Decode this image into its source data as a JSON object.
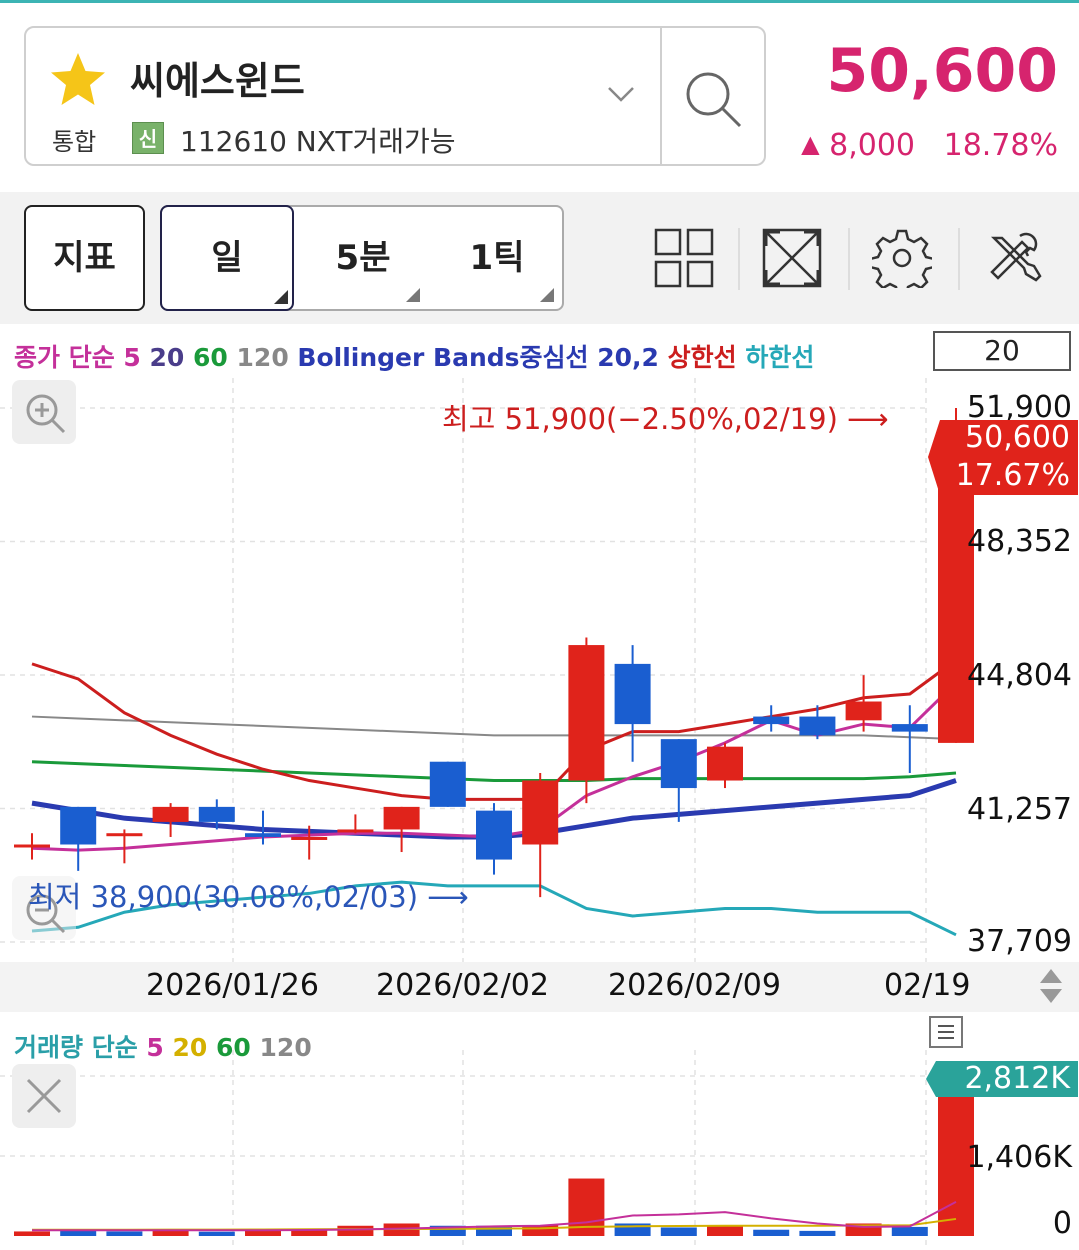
{
  "header": {
    "stock_name": "씨에스윈드",
    "market": "통합",
    "new_badge": "신",
    "code_text": "112610 NXT거래가능",
    "price": "50,600",
    "change_arrow": "▲",
    "change": "8,000",
    "change_pct": "18.78%",
    "price_color": "#d6246e"
  },
  "toolbar": {
    "indicator_label": "지표",
    "tabs": [
      {
        "label": "일",
        "selected": true
      },
      {
        "label": "5분",
        "selected": false
      },
      {
        "label": "1틱",
        "selected": false
      }
    ],
    "icons": [
      "grid-layout-icon",
      "expand-icon",
      "settings-gear-icon",
      "tools-icon"
    ]
  },
  "chart": {
    "legend_items": [
      {
        "text": "종가 단순 ",
        "color": "#c4309a"
      },
      {
        "text": "5 ",
        "color": "#c4309a"
      },
      {
        "text": "20 ",
        "color": "#4a3d8a"
      },
      {
        "text": "60 ",
        "color": "#1a9a3a"
      },
      {
        "text": "120 ",
        "color": "#888888"
      },
      {
        "text": "Bollinger Bands중심선 20,2 ",
        "color": "#2a3ab0"
      },
      {
        "text": "상한선 ",
        "color": "#cc1e1e"
      },
      {
        "text": "하한선",
        "color": "#25a8b8"
      }
    ],
    "period_value": "20",
    "high_annotation": "최고 51,900(−2.50%,02/19) ⟶",
    "low_annotation": "최저 38,900(30.08%,02/03) ⟶",
    "current_price_badge": "50,600",
    "current_pct_badge": "17.67%",
    "y_labels": [
      "51,900",
      "48,352",
      "44,804",
      "41,257",
      "37,709"
    ],
    "x_labels": [
      "2026/01/26",
      "2026/02/02",
      "2026/02/09",
      "02/19"
    ]
  },
  "volume": {
    "legend_items": [
      {
        "text": "거래량 단순 ",
        "color": "#2a9fa8"
      },
      {
        "text": "5 ",
        "color": "#c4309a"
      },
      {
        "text": "20 ",
        "color": "#d4b000"
      },
      {
        "text": "60 ",
        "color": "#1a9a3a"
      },
      {
        "text": "120",
        "color": "#888888"
      }
    ],
    "current_badge": "2,812K",
    "y_labels": [
      "1,406K",
      "0"
    ]
  },
  "chart_data": [
    {
      "type": "candlestick",
      "y_range": [
        37709,
        51900
      ],
      "y_ticks": [
        51900,
        48352,
        44804,
        41257,
        37709
      ],
      "x_ticks": [
        "2026/01/26",
        "2026/02/02",
        "2026/02/09",
        "02/19"
      ],
      "candles": [
        {
          "o": 40300,
          "h": 40600,
          "l": 39900,
          "c": 40300
        },
        {
          "o": 41300,
          "h": 41300,
          "l": 39600,
          "c": 40300
        },
        {
          "o": 40600,
          "h": 40700,
          "l": 39800,
          "c": 40600
        },
        {
          "o": 40900,
          "h": 41400,
          "l": 40500,
          "c": 41300
        },
        {
          "o": 41300,
          "h": 41500,
          "l": 40700,
          "c": 40900
        },
        {
          "o": 40600,
          "h": 41200,
          "l": 40300,
          "c": 40500
        },
        {
          "o": 40500,
          "h": 40800,
          "l": 39900,
          "c": 40500
        },
        {
          "o": 40700,
          "h": 41100,
          "l": 40600,
          "c": 40700
        },
        {
          "o": 40700,
          "h": 41300,
          "l": 40100,
          "c": 41300
        },
        {
          "o": 42500,
          "h": 42500,
          "l": 41300,
          "c": 41300
        },
        {
          "o": 41200,
          "h": 41400,
          "l": 39500,
          "c": 39900
        },
        {
          "o": 40300,
          "h": 42200,
          "l": 38900,
          "c": 42000
        },
        {
          "o": 42000,
          "h": 45800,
          "l": 41400,
          "c": 45600
        },
        {
          "o": 45100,
          "h": 45600,
          "l": 42500,
          "c": 43500
        },
        {
          "o": 43100,
          "h": 43100,
          "l": 40900,
          "c": 41800
        },
        {
          "o": 42000,
          "h": 43000,
          "l": 41800,
          "c": 42900
        },
        {
          "o": 43700,
          "h": 44000,
          "l": 43300,
          "c": 43500
        },
        {
          "o": 43700,
          "h": 44000,
          "l": 43100,
          "c": 43200
        },
        {
          "o": 43600,
          "h": 44800,
          "l": 43300,
          "c": 44100
        },
        {
          "o": 43500,
          "h": 44000,
          "l": 42200,
          "c": 43300
        },
        {
          "o": 43000,
          "h": 51900,
          "l": 43000,
          "c": 50600
        }
      ],
      "ma5": [
        40200,
        40150,
        40200,
        40300,
        40400,
        40500,
        40550,
        40600,
        40600,
        40550,
        40500,
        40700,
        41600,
        42100,
        42500,
        43000,
        43600,
        43200,
        43500,
        43400,
        44600
      ],
      "ma60": [
        42500,
        42450,
        42400,
        42350,
        42300,
        42250,
        42200,
        42150,
        42100,
        42050,
        42000,
        42000,
        42000,
        42050,
        42050,
        42050,
        42050,
        42050,
        42050,
        42100,
        42200
      ],
      "ma120": [
        43700,
        43650,
        43600,
        43550,
        43500,
        43450,
        43400,
        43350,
        43300,
        43250,
        43200,
        43200,
        43200,
        43200,
        43200,
        43200,
        43200,
        43200,
        43200,
        43150,
        43100
      ],
      "bb_mid": [
        41400,
        41200,
        41000,
        40900,
        40800,
        40700,
        40650,
        40600,
        40550,
        40500,
        40500,
        40600,
        40800,
        41000,
        41100,
        41200,
        41300,
        41400,
        41500,
        41600,
        42000
      ],
      "bb_upper": [
        45100,
        44700,
        43800,
        43200,
        42700,
        42300,
        42000,
        41800,
        41600,
        41500,
        41500,
        41500,
        42800,
        43300,
        43300,
        43500,
        43700,
        43900,
        44200,
        44300,
        45200
      ],
      "bb_lower": [
        38000,
        38100,
        38500,
        38700,
        38800,
        38900,
        39000,
        39200,
        39300,
        39200,
        39200,
        39200,
        38600,
        38400,
        38500,
        38600,
        38600,
        38500,
        38500,
        38500,
        37900
      ]
    },
    {
      "type": "bar",
      "title": "거래량",
      "y_range": [
        0,
        2812
      ],
      "y_ticks": [
        1406,
        0
      ],
      "unit": "K",
      "values": [
        80,
        90,
        80,
        90,
        75,
        110,
        130,
        180,
        220,
        180,
        180,
        190,
        1010,
        220,
        150,
        170,
        110,
        90,
        220,
        160,
        2812
      ],
      "up": [
        true,
        false,
        false,
        true,
        false,
        true,
        true,
        true,
        true,
        false,
        false,
        true,
        true,
        false,
        false,
        true,
        false,
        false,
        true,
        false,
        true
      ],
      "ma5": [
        100,
        100,
        100,
        100,
        100,
        100,
        105,
        115,
        130,
        150,
        170,
        180,
        240,
        360,
        380,
        420,
        310,
        220,
        160,
        170,
        600
      ],
      "ma20": [
        110,
        110,
        110,
        112,
        112,
        115,
        118,
        120,
        122,
        125,
        130,
        135,
        160,
        170,
        175,
        180,
        180,
        180,
        185,
        190,
        300
      ]
    }
  ]
}
